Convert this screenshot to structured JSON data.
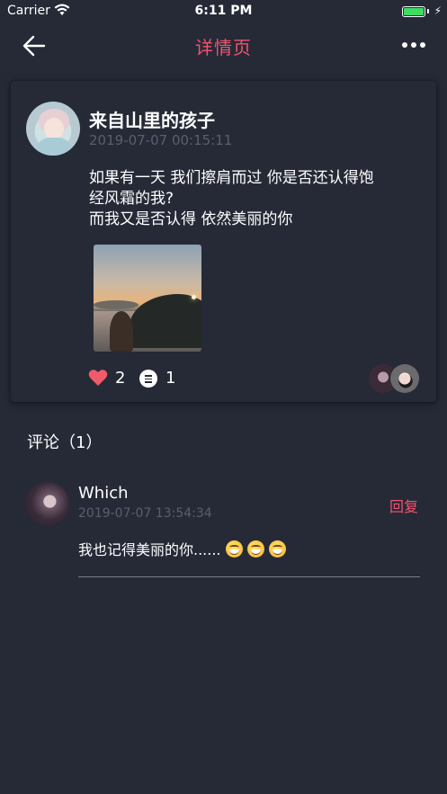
{
  "status_bar": {
    "carrier": "Carrier",
    "time": "6:11 PM",
    "battery_color": "#3ddc63"
  },
  "nav": {
    "title": "详情页",
    "title_color": "#f2546e",
    "back_icon": "arrow-left-icon",
    "more_icon": "more-dots-icon"
  },
  "post": {
    "author": "来自山里的孩子",
    "time": "2019-07-07 00:15:11",
    "text_lines": [
      "如果有一天 我们擦肩而过 你是否还认得饱",
      "经风霜的我?",
      "而我又是否认得 依然美丽的你"
    ],
    "like_count": "2",
    "comment_count": "1"
  },
  "comments": {
    "title": "评论（1）",
    "items": [
      {
        "author": "Which",
        "time": "2019-07-07 13:54:34",
        "text": "我也记得美丽的你......",
        "reply_label": "回复"
      }
    ]
  }
}
